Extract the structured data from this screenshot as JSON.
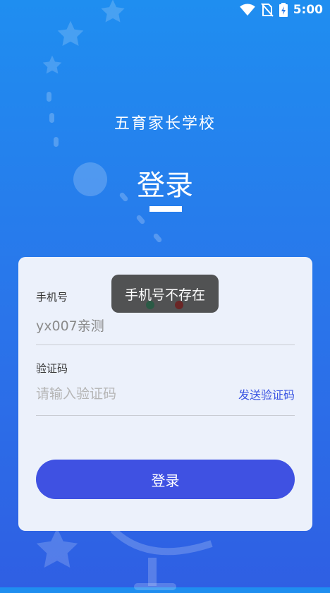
{
  "status_bar": {
    "time": "5:00",
    "icons": [
      "wifi-icon",
      "no-sim-icon",
      "battery-charging-icon"
    ]
  },
  "header": {
    "app_title": "五育家长学校",
    "page_title": "登录"
  },
  "form": {
    "phone_label": "手机号",
    "phone_value": "yx007亲测",
    "code_label": "验证码",
    "code_placeholder": "请输入验证码",
    "send_code_label": "发送验证码",
    "submit_label": "登录"
  },
  "toast": {
    "message": "手机号不存在"
  },
  "colors": {
    "background_top": "#1f8ef0",
    "background_bottom": "#2f5fe3",
    "card": "#ecf1fb",
    "primary": "#3f51e2",
    "link": "#3b55e2"
  }
}
